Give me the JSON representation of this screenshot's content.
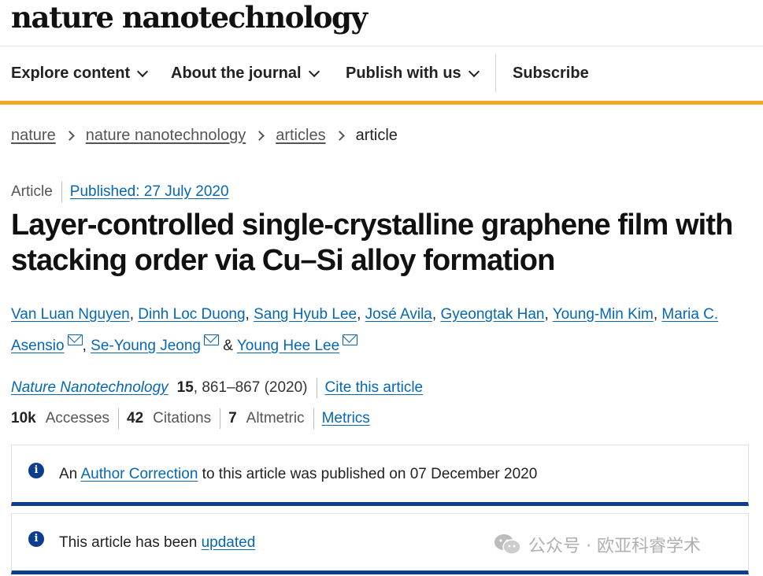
{
  "brand": {
    "logo_text": "nature nanotechnology"
  },
  "nav": {
    "items": [
      {
        "label": "Explore content"
      },
      {
        "label": "About the journal"
      },
      {
        "label": "Publish with us"
      },
      {
        "label": "Subscribe"
      }
    ]
  },
  "breadcrumb": {
    "items": [
      {
        "label": "nature"
      },
      {
        "label": "nature nanotechnology"
      },
      {
        "label": "articles"
      },
      {
        "label": "article"
      }
    ]
  },
  "article": {
    "type": "Article",
    "published": "Published: 27 July 2020",
    "title": "Layer-controlled single-crystalline graphene film with stacking order via Cu–Si alloy formation",
    "authors": [
      {
        "name": "Van Luan Nguyen"
      },
      {
        "name": "Dinh Loc Duong"
      },
      {
        "name": "Sang Hyub Lee"
      },
      {
        "name": "José Avila"
      },
      {
        "name": "Gyeongtak Han"
      },
      {
        "name": "Young-Min Kim"
      },
      {
        "name": "Maria C. Asensio"
      },
      {
        "name": "Se-Young Jeong"
      },
      {
        "name": "Young Hee Lee"
      }
    ],
    "author_sep": ", ",
    "author_amp": " & ",
    "journal": {
      "name": "Nature Nanotechnology",
      "volume": "15",
      "pages_year": ", 861–867 (2020)",
      "cite_label": "Cite this article"
    },
    "metrics": {
      "accesses_value": "10k",
      "accesses_label": "Accesses",
      "citations_value": "42",
      "citations_label": "Citations",
      "altmetric_value": "7",
      "altmetric_label": "Altmetric",
      "link_label": "Metrics"
    }
  },
  "notices": {
    "correction": {
      "prefix": "An ",
      "link": "Author Correction",
      "suffix": " to this article was published on 07 December 2020"
    },
    "update": {
      "prefix": "This article has been ",
      "link": "updated"
    },
    "icon": "info-icon",
    "accent_color": "#0d3d8f"
  },
  "watermark": {
    "text": "公众号 · 欧亚科睿学术",
    "icon": "wechat-icon"
  },
  "colors": {
    "link": "#0667b4",
    "nav_accent": "#f5a623",
    "notice_border": "#0d3d8f"
  }
}
